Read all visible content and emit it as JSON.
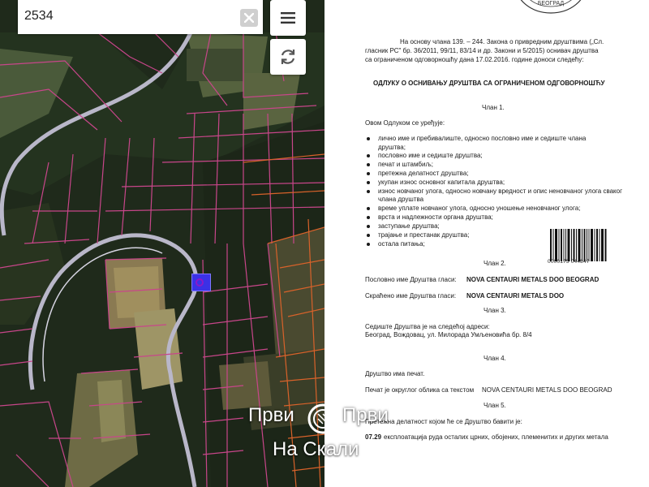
{
  "map": {
    "search": {
      "value": "2534",
      "placeholder": ""
    },
    "icons": {
      "clear": "close-icon",
      "menu": "hamburger-menu-icon",
      "refresh": "refresh-icon",
      "marker": "parcel-marker-icon"
    },
    "colors": {
      "parcel_lines": "#c8468a",
      "road": "#b9b7c9",
      "marker": "#3b31e6",
      "accent_line": "#d8622a"
    }
  },
  "document": {
    "stamp_text": "БЕОГРАД",
    "intro_line1": "На основу члана 139. – 244. Закона о привредним друштвима („Сл.",
    "intro_line2": "гласник РС\" бр. 36/2011, 99/11, 83/14 и др. Закони и 5/2015) оснивач друштва",
    "intro_line3": "са ограниченом одговорношћу дана 17.02.2016. године доноси следећу:",
    "heading": "ОДЛУКУ О ОСНИВАЊУ ДРУШТВА СА ОГРАНИЧЕНОМ ОДГОВОРНОШЋУ",
    "art1_title": "Члан 1.",
    "art1_text": "Овом Одлуком се уређује:",
    "art1_items": [
      "лично име и пребивалиште, односно пословно име и седиште члана друштва;",
      "пословно име и седиште друштва;",
      "печат и штамбиљ;",
      "претежна делатност друштва;",
      "укупан износ основног капитала друштва;",
      "износ новчаног улога, односно новчану вредност и опис неновчаног улога сваког члана друштва",
      "време уплате новчаног улога, односно уношење неновчаног улога;",
      "врста и надлежности органа друштва;",
      "заступање друштва;",
      "трајање и престанак друштва;",
      "остала питања;"
    ],
    "barcode_number": "0000175 044847",
    "art2_title": "Члан 2.",
    "art2_line1_label": "Пословно име Друштва гласи:",
    "art2_line1_value": "NOVA CENTAURI METALS DOO BEOGRAD",
    "art2_line2_label": "Скраћено име Друштва гласи:",
    "art2_line2_value": "NOVA CENTAURI METALS DOO",
    "art3_title": "Члан 3.",
    "art3_line1": "Седиште Друштва је на следећој адреси:",
    "art3_line2": "Београд, Вождовац, ул. Милорада Умљеновића бр. 8/4",
    "art4_title": "Члан 4.",
    "art4_line1": "Друштво има печат.",
    "art4_line2_label": "Печат је округлог облика са текстом",
    "art4_line2_value": "NOVA CENTAURI METALS DOO BEOGRAD",
    "art5_title": "Члан 5.",
    "art5_line1": "Претежна делатност којом ће се Друштво бавити је:",
    "art5_code": "07.29",
    "art5_desc": "експлоатација руда осталих црних, обојених, племенитих и других метала"
  },
  "watermark": {
    "word_left": "Први",
    "word_right": "Први",
    "word_bottom": "На Скали",
    "logo_icon": "ring-logo-icon"
  }
}
